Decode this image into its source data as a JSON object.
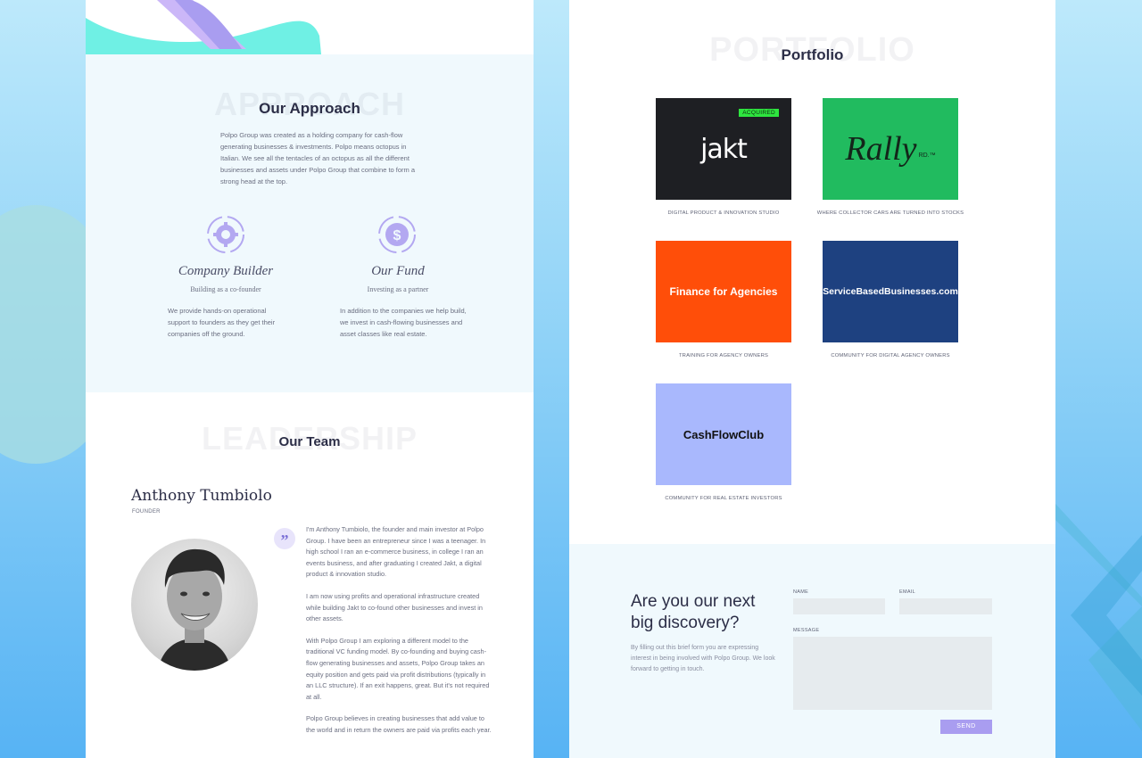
{
  "approach": {
    "ghost": "APPROACH",
    "title": "Our Approach",
    "description": "Polpo Group was created as a holding company for cash-flow generating businesses & investments. Polpo means octopus in Italian. We see all the tentacles of an octopus as all the different businesses and assets under Polpo Group that combine to form a strong head at the top."
  },
  "pillars": [
    {
      "icon": "gear-cycle-icon",
      "title": "Company Builder",
      "subtitle": "Building as a co-founder",
      "text": "We provide hands-on operational support to founders as they get their companies off the ground."
    },
    {
      "icon": "dollar-cycle-icon",
      "title": "Our Fund",
      "subtitle": "Investing as a partner",
      "text": "In addition to the companies we help build, we invest in cash-flowing businesses and asset classes like real estate."
    }
  ],
  "team": {
    "ghost": "LEADERSHIP",
    "title": "Our Team",
    "person": {
      "name": "Anthony Tumbiolo",
      "role": "FOUNDER",
      "quote_mark": "”",
      "bio": [
        "I'm Anthony Tumbiolo, the founder and main investor at Polpo Group. I have been an entrepreneur since I was a teenager. In high school I ran an e-commerce business, in college I ran an events business, and after graduating I created Jakt, a digital product & innovation studio.",
        "I am now using profits and operational infrastructure created while building Jakt to co-found other businesses and invest in other assets.",
        "With Polpo Group I am exploring a different model to the traditional VC funding model. By co-founding and buying cash-flow generating businesses and assets, Polpo Group takes an equity position and gets paid via profit distributions (typically in an LLC structure). If an exit happens, great. But it's not required at all.",
        "Polpo Group believes in creating businesses that add value to the world and in return the owners are paid via profits each year."
      ]
    }
  },
  "portfolio": {
    "ghost": "PORTFOLIO",
    "title": "Portfolio",
    "items": [
      {
        "logo": "jakt",
        "badge": "ACQUIRED",
        "bg": "#1e1f23",
        "fg": "#ffffff",
        "caption": "DIGITAL PRODUCT & INNOVATION STUDIO"
      },
      {
        "logo": "Rally",
        "logo_suffix": "RD.™",
        "bg": "#21bb5f",
        "fg": "#13261a",
        "caption": "WHERE COLLECTOR CARS ARE TURNED INTO STOCKS"
      },
      {
        "logo": "Finance for Agencies",
        "bg": "#ff4e09",
        "fg": "#ffffff",
        "caption": "TRAINING FOR AGENCY OWNERS"
      },
      {
        "logo": "ServiceBasedBusinesses.com",
        "bg": "#1e4180",
        "fg": "#ffffff",
        "caption": "COMMUNITY FOR DIGITAL AGENCY OWNERS"
      },
      {
        "logo": "CashFlowClub",
        "bg": "#a9b8fd",
        "fg": "#111111",
        "caption": "COMMUNITY FOR REAL ESTATE INVESTORS"
      }
    ]
  },
  "contact": {
    "heading_line1": "Are you our next",
    "heading_line2": "big discovery?",
    "text": "By filling out this brief form you are expressing interest in being involved with Polpo Group. We look forward to getting in touch.",
    "name_label": "NAME",
    "email_label": "EMAIL",
    "message_label": "MESSAGE",
    "send_label": "SEND"
  },
  "colors": {
    "accent": "#a99df0",
    "icon_purple": "#8b7fe8",
    "teal": "#6ff0e4",
    "light_bg": "#f0f9fd"
  }
}
